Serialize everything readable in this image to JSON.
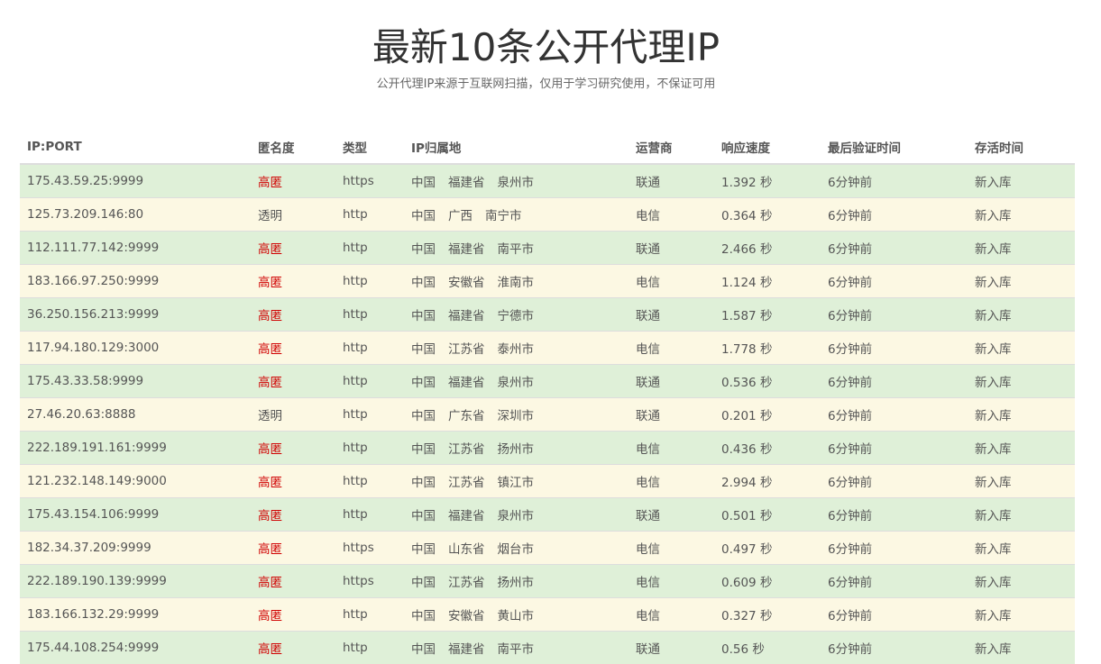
{
  "page": {
    "title": "最新10条公开代理IP",
    "subtitle": "公开代理IP来源于互联网扫描，仅用于学习研究使用，不保证可用"
  },
  "colors": {
    "row_green": "#dff0d8",
    "row_yellow": "#fcf8e3",
    "anonymity_high": "#d00000",
    "text": "#555555"
  },
  "table": {
    "headers": {
      "ip_port": "IP:PORT",
      "anonymity": "匿名度",
      "type": "类型",
      "location": "IP归属地",
      "isp": "运营商",
      "speed": "响应速度",
      "last_verified": "最后验证时间",
      "alive_time": "存活时间"
    },
    "rows": [
      {
        "ip_port": "175.43.59.25:9999",
        "anonymity": "高匿",
        "type": "https",
        "country": "中国",
        "province": "福建省",
        "city": "泉州市",
        "isp": "联通",
        "speed": "1.392 秒",
        "last_verified": "6分钟前",
        "alive_time": "新入库"
      },
      {
        "ip_port": "125.73.209.146:80",
        "anonymity": "透明",
        "type": "http",
        "country": "中国",
        "province": "广西",
        "city": "南宁市",
        "isp": "电信",
        "speed": "0.364 秒",
        "last_verified": "6分钟前",
        "alive_time": "新入库"
      },
      {
        "ip_port": "112.111.77.142:9999",
        "anonymity": "高匿",
        "type": "http",
        "country": "中国",
        "province": "福建省",
        "city": "南平市",
        "isp": "联通",
        "speed": "2.466 秒",
        "last_verified": "6分钟前",
        "alive_time": "新入库"
      },
      {
        "ip_port": "183.166.97.250:9999",
        "anonymity": "高匿",
        "type": "http",
        "country": "中国",
        "province": "安徽省",
        "city": "淮南市",
        "isp": "电信",
        "speed": "1.124 秒",
        "last_verified": "6分钟前",
        "alive_time": "新入库"
      },
      {
        "ip_port": "36.250.156.213:9999",
        "anonymity": "高匿",
        "type": "http",
        "country": "中国",
        "province": "福建省",
        "city": "宁德市",
        "isp": "联通",
        "speed": "1.587 秒",
        "last_verified": "6分钟前",
        "alive_time": "新入库"
      },
      {
        "ip_port": "117.94.180.129:3000",
        "anonymity": "高匿",
        "type": "http",
        "country": "中国",
        "province": "江苏省",
        "city": "泰州市",
        "isp": "电信",
        "speed": "1.778 秒",
        "last_verified": "6分钟前",
        "alive_time": "新入库"
      },
      {
        "ip_port": "175.43.33.58:9999",
        "anonymity": "高匿",
        "type": "http",
        "country": "中国",
        "province": "福建省",
        "city": "泉州市",
        "isp": "联通",
        "speed": "0.536 秒",
        "last_verified": "6分钟前",
        "alive_time": "新入库"
      },
      {
        "ip_port": "27.46.20.63:8888",
        "anonymity": "透明",
        "type": "http",
        "country": "中国",
        "province": "广东省",
        "city": "深圳市",
        "isp": "联通",
        "speed": "0.201 秒",
        "last_verified": "6分钟前",
        "alive_time": "新入库"
      },
      {
        "ip_port": "222.189.191.161:9999",
        "anonymity": "高匿",
        "type": "http",
        "country": "中国",
        "province": "江苏省",
        "city": "扬州市",
        "isp": "电信",
        "speed": "0.436 秒",
        "last_verified": "6分钟前",
        "alive_time": "新入库"
      },
      {
        "ip_port": "121.232.148.149:9000",
        "anonymity": "高匿",
        "type": "http",
        "country": "中国",
        "province": "江苏省",
        "city": "镇江市",
        "isp": "电信",
        "speed": "2.994 秒",
        "last_verified": "6分钟前",
        "alive_time": "新入库"
      },
      {
        "ip_port": "175.43.154.106:9999",
        "anonymity": "高匿",
        "type": "http",
        "country": "中国",
        "province": "福建省",
        "city": "泉州市",
        "isp": "联通",
        "speed": "0.501 秒",
        "last_verified": "6分钟前",
        "alive_time": "新入库"
      },
      {
        "ip_port": "182.34.37.209:9999",
        "anonymity": "高匿",
        "type": "https",
        "country": "中国",
        "province": "山东省",
        "city": "烟台市",
        "isp": "电信",
        "speed": "0.497 秒",
        "last_verified": "6分钟前",
        "alive_time": "新入库"
      },
      {
        "ip_port": "222.189.190.139:9999",
        "anonymity": "高匿",
        "type": "https",
        "country": "中国",
        "province": "江苏省",
        "city": "扬州市",
        "isp": "电信",
        "speed": "0.609 秒",
        "last_verified": "6分钟前",
        "alive_time": "新入库"
      },
      {
        "ip_port": "183.166.132.29:9999",
        "anonymity": "高匿",
        "type": "http",
        "country": "中国",
        "province": "安徽省",
        "city": "黄山市",
        "isp": "电信",
        "speed": "0.327 秒",
        "last_verified": "6分钟前",
        "alive_time": "新入库"
      },
      {
        "ip_port": "175.44.108.254:9999",
        "anonymity": "高匿",
        "type": "http",
        "country": "中国",
        "province": "福建省",
        "city": "南平市",
        "isp": "联通",
        "speed": "0.56 秒",
        "last_verified": "6分钟前",
        "alive_time": "新入库"
      }
    ]
  }
}
